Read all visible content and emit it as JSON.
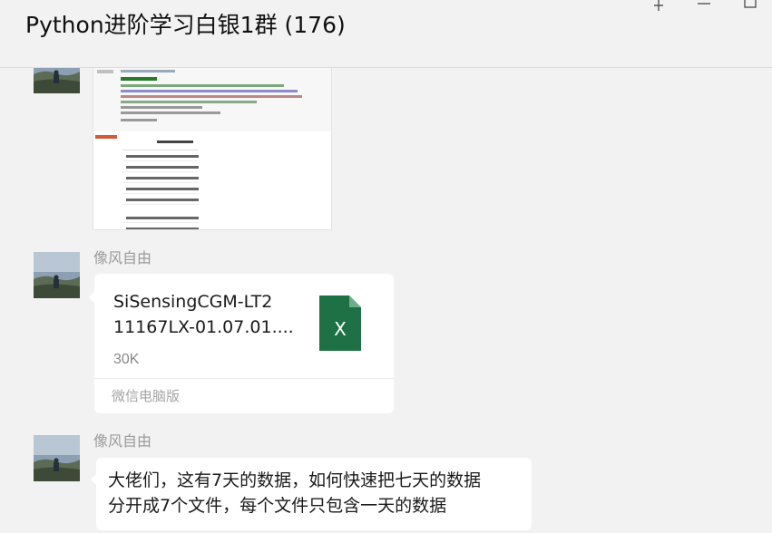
{
  "chat": {
    "title": "Python进阶学习白银1群 (176)"
  },
  "window_controls": {
    "pin_icon": "pin-icon",
    "minimize_icon": "minimize-icon",
    "maximize_icon": "maximize-icon"
  },
  "messages": [
    {
      "type": "image",
      "sender": "",
      "content": "code-screenshot"
    },
    {
      "type": "file",
      "sender": "像风自由",
      "file": {
        "name_line1": "SiSensingCGM-LT2",
        "name_line2": "11167LX-01.07.01....",
        "size": "30K",
        "source": "微信电脑版",
        "icon": "excel-file-icon",
        "icon_letter": "X",
        "icon_color": "#1e7145"
      }
    },
    {
      "type": "text",
      "sender": "像风自由",
      "line1": "大佬们，这有7天的数据，如何快速把七天的数据",
      "line2": "分开成7个文件，每个文件只包含一天的数据"
    }
  ],
  "colors": {
    "background": "#f2f2f2",
    "bubble": "#ffffff",
    "sender_name": "#9a9a9a",
    "excel_green": "#1e7145"
  }
}
